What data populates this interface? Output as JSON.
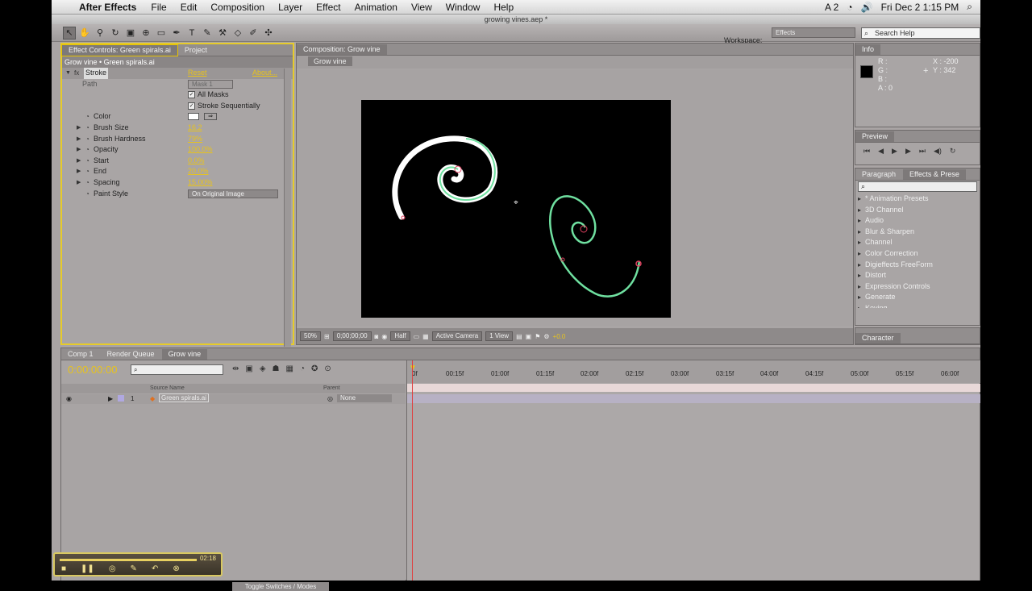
{
  "menubar": {
    "app_name": "After Effects",
    "items": [
      "File",
      "Edit",
      "Composition",
      "Layer",
      "Effect",
      "Animation",
      "View",
      "Window",
      "Help"
    ],
    "status_text": "A 2",
    "clock": "Fri Dec 2  1:15 PM"
  },
  "window": {
    "title": "growing vines.aep *"
  },
  "toolbar": {
    "workspace_label": "Workspace:",
    "workspace_value": "Effects",
    "search_placeholder": "Search Help"
  },
  "effect_controls": {
    "tabs": [
      "Effect Controls: Green spirals.ai",
      "Project"
    ],
    "header": "Grow vine • Green spirals.ai",
    "effect_name": "Stroke",
    "reset": "Reset",
    "about": "About...",
    "path_label": "Path",
    "path_value": "Mask 1",
    "all_masks": "All Masks",
    "stroke_seq": "Stroke Sequentially",
    "color_label": "Color",
    "params": [
      {
        "label": "Brush Size",
        "value": "16.2"
      },
      {
        "label": "Brush Hardness",
        "value": "79%"
      },
      {
        "label": "Opacity",
        "value": "100.0%"
      },
      {
        "label": "Start",
        "value": "0.0%"
      },
      {
        "label": "End",
        "value": "20.0%"
      },
      {
        "label": "Spacing",
        "value": "15.00%"
      }
    ],
    "paint_style_label": "Paint Style",
    "paint_style_value": "On Original Image"
  },
  "composition": {
    "tab": "Composition: Grow vine",
    "subtab": "Grow vine",
    "zoom": "50%",
    "timecode": "0;00;00;00",
    "resolution": "Half",
    "camera": "Active Camera",
    "views": "1 View",
    "exposure": "+0.0"
  },
  "info": {
    "tab": "Info",
    "r": "R :",
    "g": "G :",
    "b": "B :",
    "a": "A : 0",
    "x": "X : -200",
    "y": "Y : 342"
  },
  "preview": {
    "tab": "Preview"
  },
  "effects_presets": {
    "tabs": [
      "Paragraph",
      "Effects & Prese"
    ],
    "items": [
      "* Animation Presets",
      "3D Channel",
      "Audio",
      "Blur & Sharpen",
      "Channel",
      "Color Correction",
      "Digieffects FreeForm",
      "Distort",
      "Expression Controls",
      "Generate",
      "Keying"
    ]
  },
  "character": {
    "tab": "Character"
  },
  "timeline": {
    "tabs": [
      "Comp 1",
      "Render Queue",
      "Grow vine"
    ],
    "timecode": "0:00:00:00",
    "ticks": [
      "0f",
      "00:15f",
      "01:00f",
      "01:15f",
      "02:00f",
      "02:15f",
      "03:00f",
      "03:15f",
      "04:00f",
      "04:15f",
      "05:00f",
      "05:15f",
      "06:00f"
    ],
    "col_source": "Source Name",
    "col_parent": "Parent",
    "layer_num": "1",
    "layer_name": "Green spirals.ai",
    "layer_parent": "None",
    "toggle_label": "Toggle Switches / Modes"
  },
  "recorder": {
    "time": "02:18"
  }
}
